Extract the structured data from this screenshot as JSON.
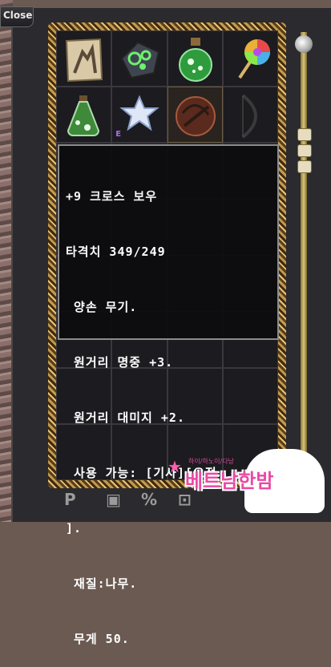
{
  "window": {
    "close_label": "Close"
  },
  "inventory": {
    "slots": [
      {
        "name": "scroll-map-icon"
      },
      {
        "name": "magic-gem-icon"
      },
      {
        "name": "green-potion-icon"
      },
      {
        "name": "lollipop-icon"
      },
      {
        "name": "green-potion-2-icon"
      },
      {
        "name": "white-crystal-icon",
        "badge": "E"
      },
      {
        "name": "crossbow-icon"
      },
      {
        "name": "bow-icon"
      }
    ]
  },
  "tooltip": {
    "lines": [
      "+9 크로스 보우",
      "타격치 349/249",
      " 양손 무기.",
      " 원거리 명중 +3.",
      " 원거리 대미지 +2.",
      " 사용 가능: [기사][요정",
      "].",
      " 재질:나무.",
      " 무게 50."
    ]
  },
  "bottom_bar": {
    "p_label": "P",
    "percent_label": "%"
  },
  "watermark": {
    "text": "베트남한밤",
    "sub": "하이/하노이/다낭"
  }
}
